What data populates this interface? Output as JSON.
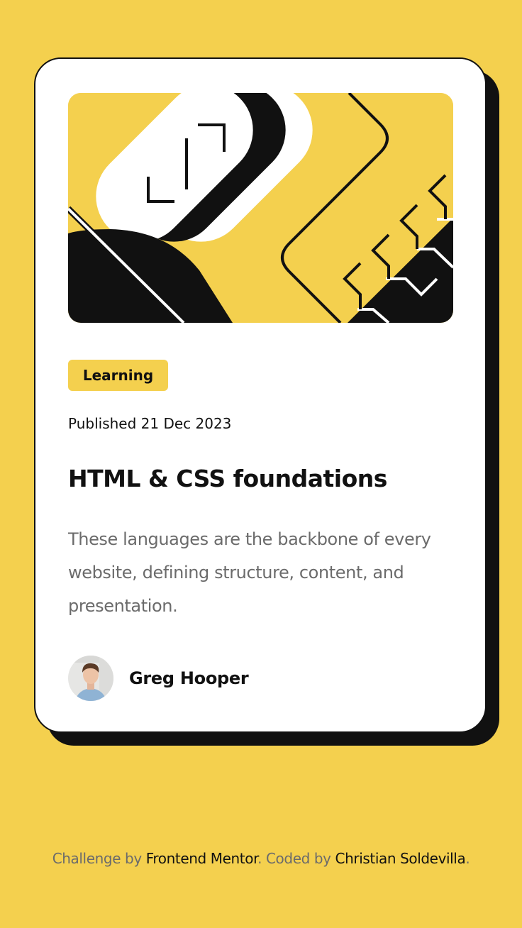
{
  "card": {
    "category": "Learning",
    "published": "Published 21 Dec 2023",
    "title": "HTML & CSS foundations",
    "description": "These languages are the backbone of every website, defining structure, content, and presentation."
  },
  "author": {
    "name": "Greg Hooper"
  },
  "attribution": {
    "prefix": "Challenge by ",
    "challenge_link": "Frontend Mentor",
    "middle": ". Coded by ",
    "coder_link": "Christian Soldevilla",
    "suffix": "."
  },
  "colors": {
    "background": "#F4D04E",
    "card": "#FFFFFF",
    "ink": "#111111",
    "muted": "#6B6B6B"
  },
  "icons": {
    "illustration": "abstract-shapes-illustration",
    "avatar": "author-portrait"
  }
}
